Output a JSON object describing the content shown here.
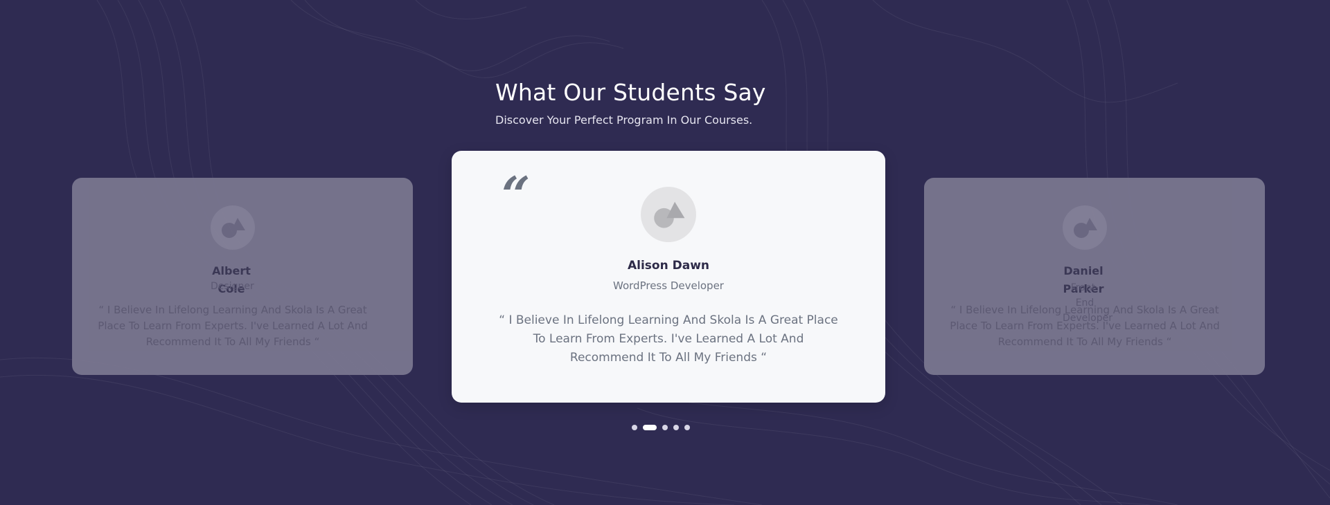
{
  "section": {
    "title": "What Our Students Say",
    "subtitle": "Discover Your Perfect Program In Our Courses."
  },
  "testimonials": [
    {
      "name": "Albert Cole",
      "role": "Designer",
      "quote": "“ I Believe In Lifelong Learning And Skola Is A Great Place To Learn From Experts. I've Learned A Lot And Recommend It To All My Friends “"
    },
    {
      "name": "Alison Dawn",
      "role": "WordPress Developer",
      "quote": "“ I Believe In Lifelong Learning And Skola Is A Great Place To Learn From Experts. I've Learned A Lot And Recommend It To All My Friends “"
    },
    {
      "name": "Daniel Parker",
      "role": "Front-End Developer",
      "quote": "“ I Believe In Lifelong Learning And Skola Is A Great Place To Learn From Experts. I've Learned A Lot And Recommend It To All My Friends “"
    }
  ],
  "pagination": {
    "count": 5,
    "active_index": 1
  },
  "colors": {
    "background": "#2f2b52",
    "card": "#f7f8fa",
    "side_card": "#79768f"
  }
}
